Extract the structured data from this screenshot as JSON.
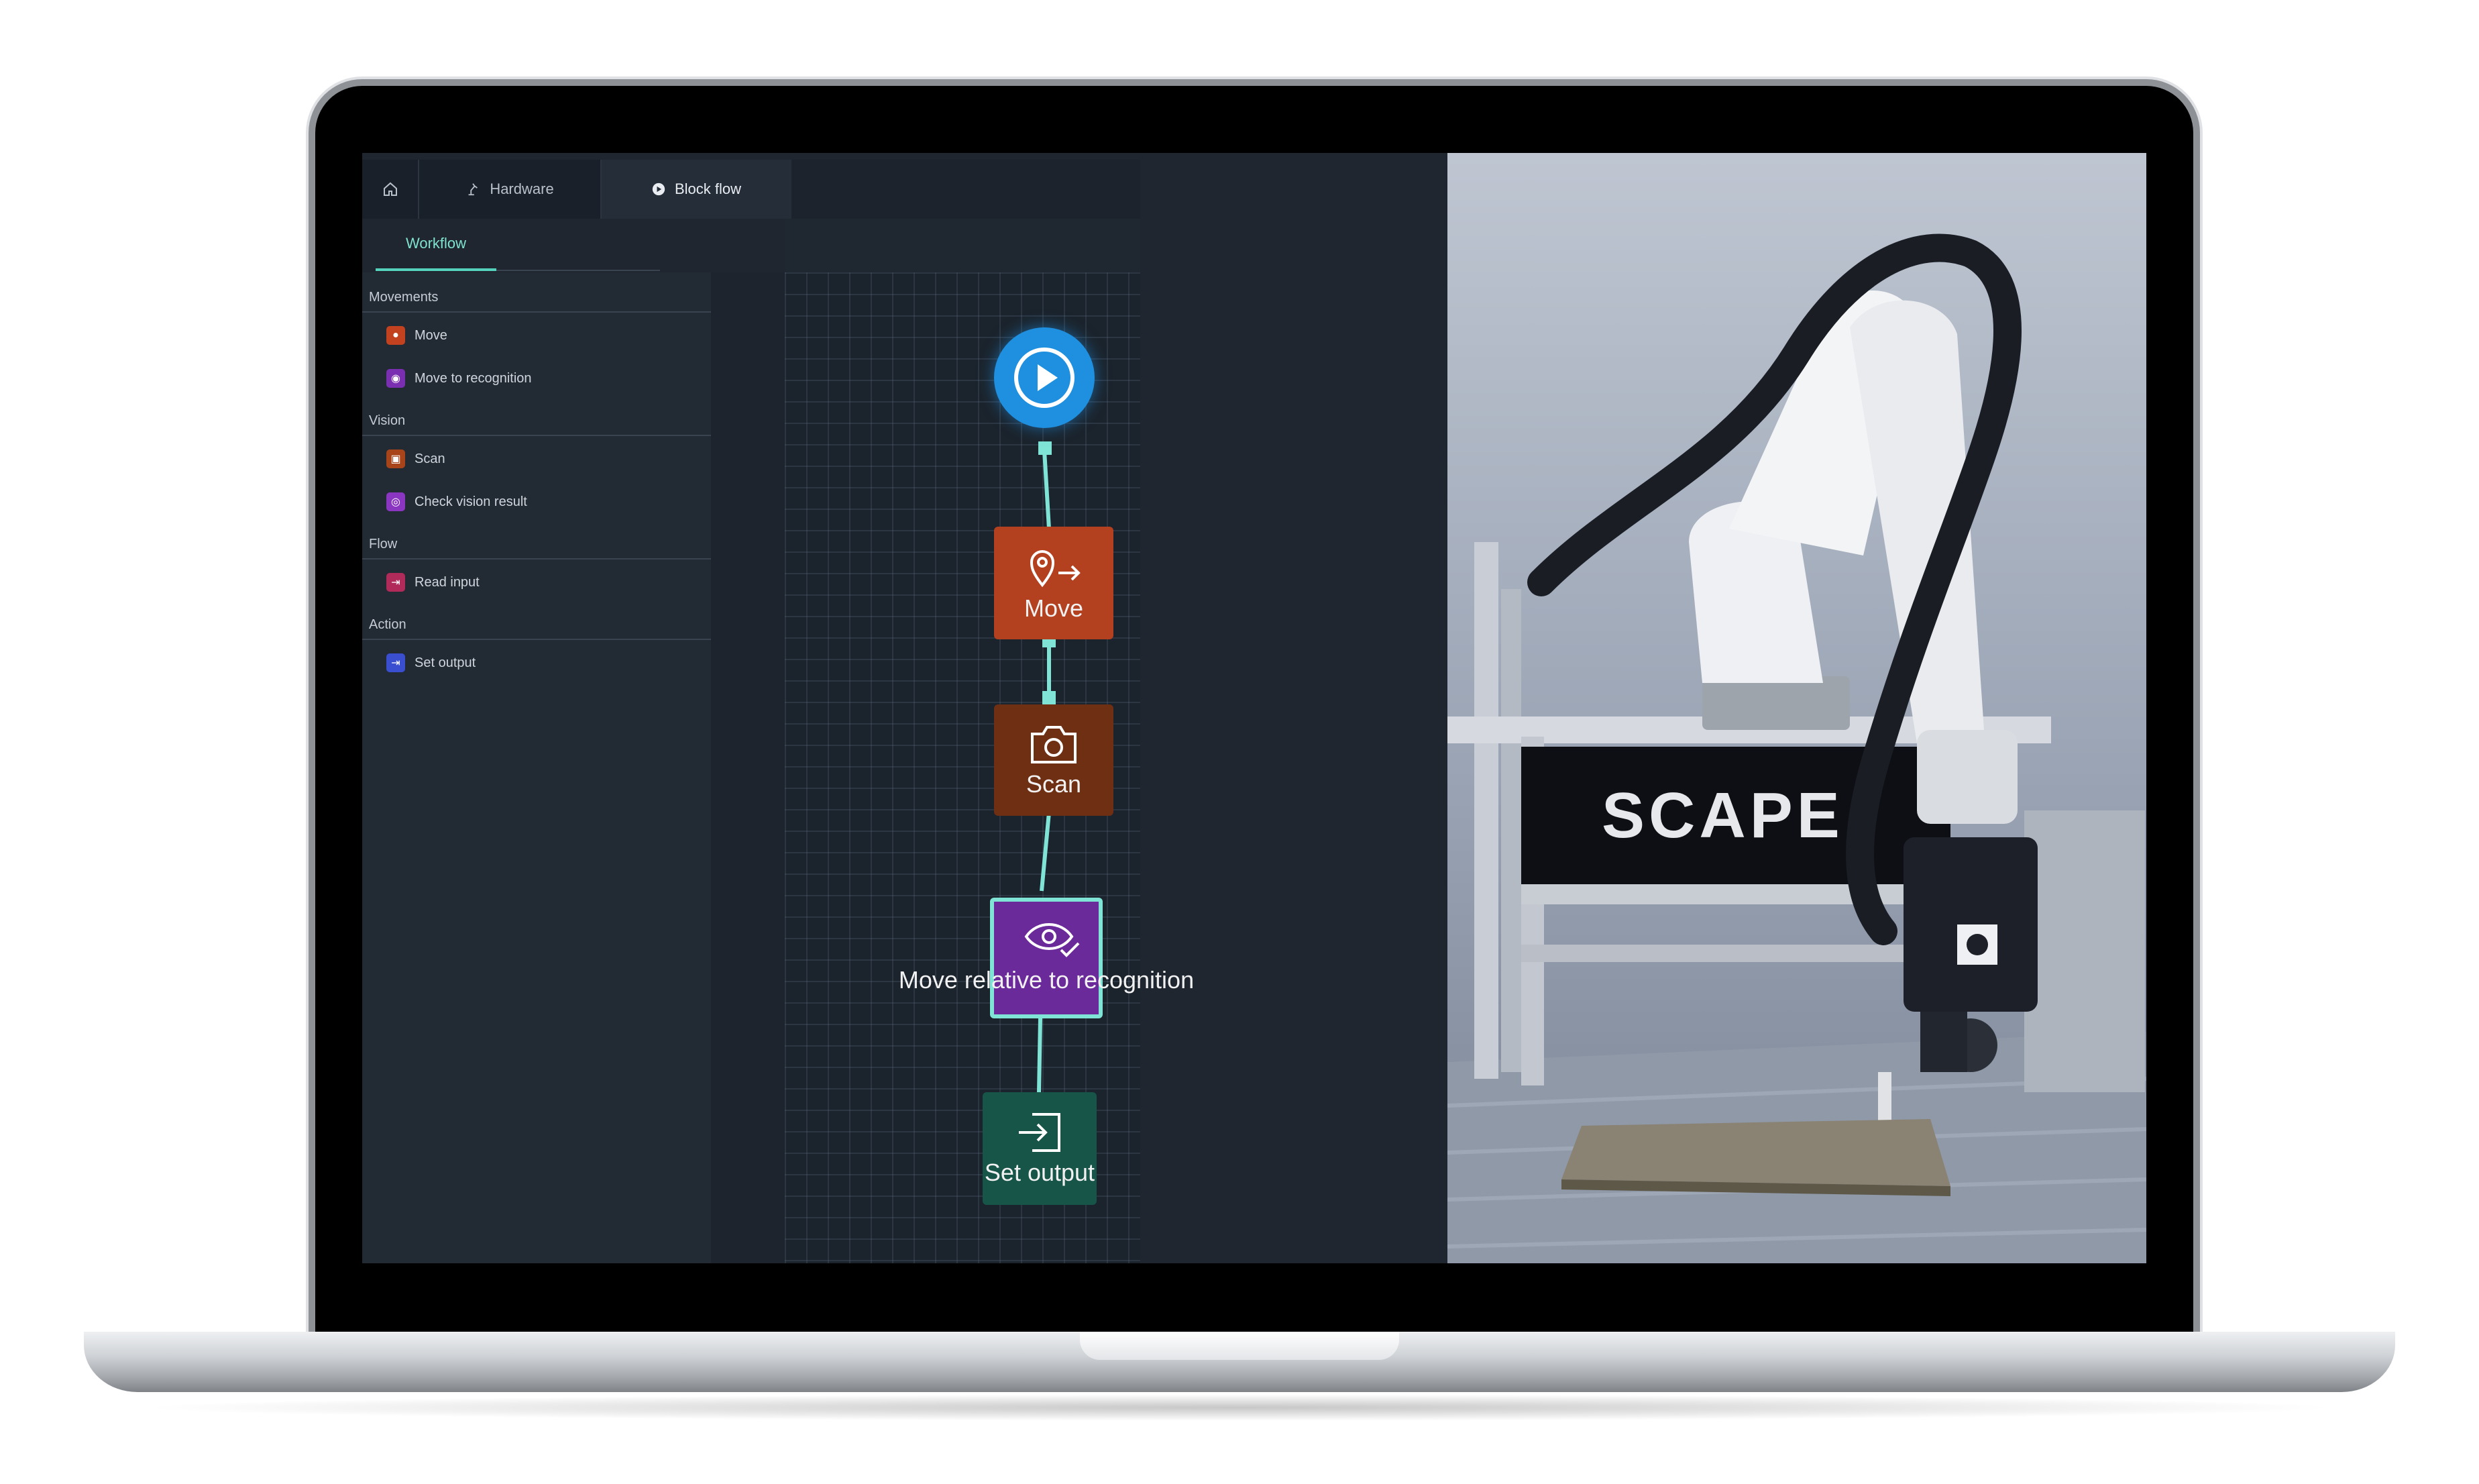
{
  "tabs": {
    "home_icon": "home-icon",
    "hardware": "Hardware",
    "hardware_icon": "robot-arm-icon",
    "block_flow": "Block flow",
    "block_flow_icon": "play-icon"
  },
  "subtabs": {
    "workflow": "Workflow"
  },
  "sidebar": {
    "sections": [
      {
        "title": "Movements",
        "items": [
          {
            "label": "Move",
            "icon": "move-icon",
            "color": "#c2421f"
          },
          {
            "label": "Move to recognition",
            "icon": "target-icon",
            "color": "#7a2fb0"
          }
        ]
      },
      {
        "title": "Vision",
        "items": [
          {
            "label": "Scan",
            "icon": "camera-icon",
            "color": "#a8441a"
          },
          {
            "label": "Check vision result",
            "icon": "eye-icon",
            "color": "#8a36c0"
          }
        ]
      },
      {
        "title": "Flow",
        "items": [
          {
            "label": "Read input",
            "icon": "input-icon",
            "color": "#b02a5a"
          }
        ]
      },
      {
        "title": "Action",
        "items": [
          {
            "label": "Set output",
            "icon": "output-icon",
            "color": "#3a4fd0"
          }
        ]
      }
    ]
  },
  "flow": {
    "start_icon": "play-icon",
    "nodes": [
      {
        "label": "Move",
        "icon": "move-icon",
        "color": "#b3401e"
      },
      {
        "label": "Scan",
        "icon": "camera-icon",
        "color": "#6e2f12"
      },
      {
        "label": "Move relative to recognition",
        "icon": "eye-check-icon",
        "color": "#6a2a9a"
      },
      {
        "label": "Set output",
        "icon": "output-icon",
        "color": "#175549"
      }
    ],
    "connector_color": "#7fe3d6",
    "accent": "#1f8fe0"
  },
  "photo": {
    "brand_text": "SCAPE"
  }
}
